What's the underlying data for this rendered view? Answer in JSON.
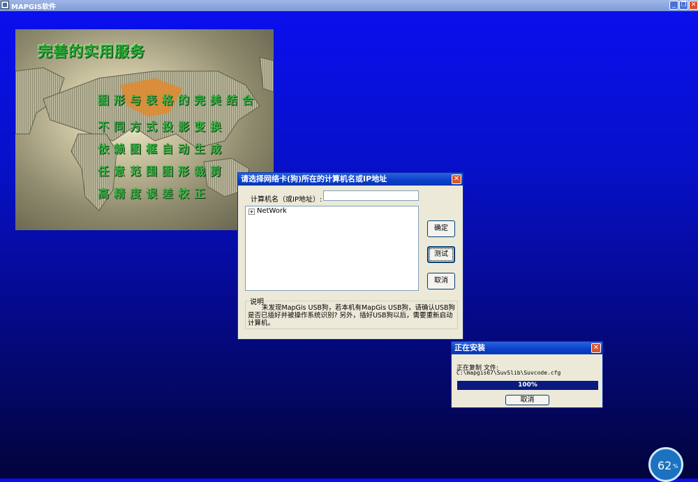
{
  "window": {
    "title": "MAPGIS软件"
  },
  "splash": {
    "heading": "完善的实用服务",
    "lines": [
      "图形与表格的完美结合",
      "不同方式投影变换",
      "依赖图框自动生成",
      "任意范围图形裁剪",
      "高精度误差校正"
    ]
  },
  "network_dialog": {
    "title": "请选择网络卡(狗)所在的计算机名或IP地址",
    "computer_label": "计算机名（或IP地址）:",
    "computer_value": "",
    "tree_expander": "+",
    "tree_root": "NetWork",
    "ok_label": "确定",
    "test_label": "测试",
    "cancel_label": "取消",
    "desc_legend": "说明",
    "desc_text": "未发现MapGis USB狗，若本机有MapGis USB狗，请确认USB狗是否已插好并被操作系统识别? 另外，插好USB狗以后，需要重新启动计算机。"
  },
  "install_dialog": {
    "title": "正在安装",
    "copying_label": "正在复制 文件:",
    "file_path": "C:\\mapgis67\\SuvSlib\\Suvcode.cfg",
    "progress_text": "100%",
    "cancel_label": "取消"
  },
  "badge": {
    "value": "62",
    "unit": "%"
  },
  "colors": {
    "desktop_top": "#0a0ff0",
    "desktop_bottom": "#02043a",
    "dialog_face": "#ece9d8",
    "caption_blue": "#0a3fc8",
    "progress_fill": "#0a1a80"
  }
}
